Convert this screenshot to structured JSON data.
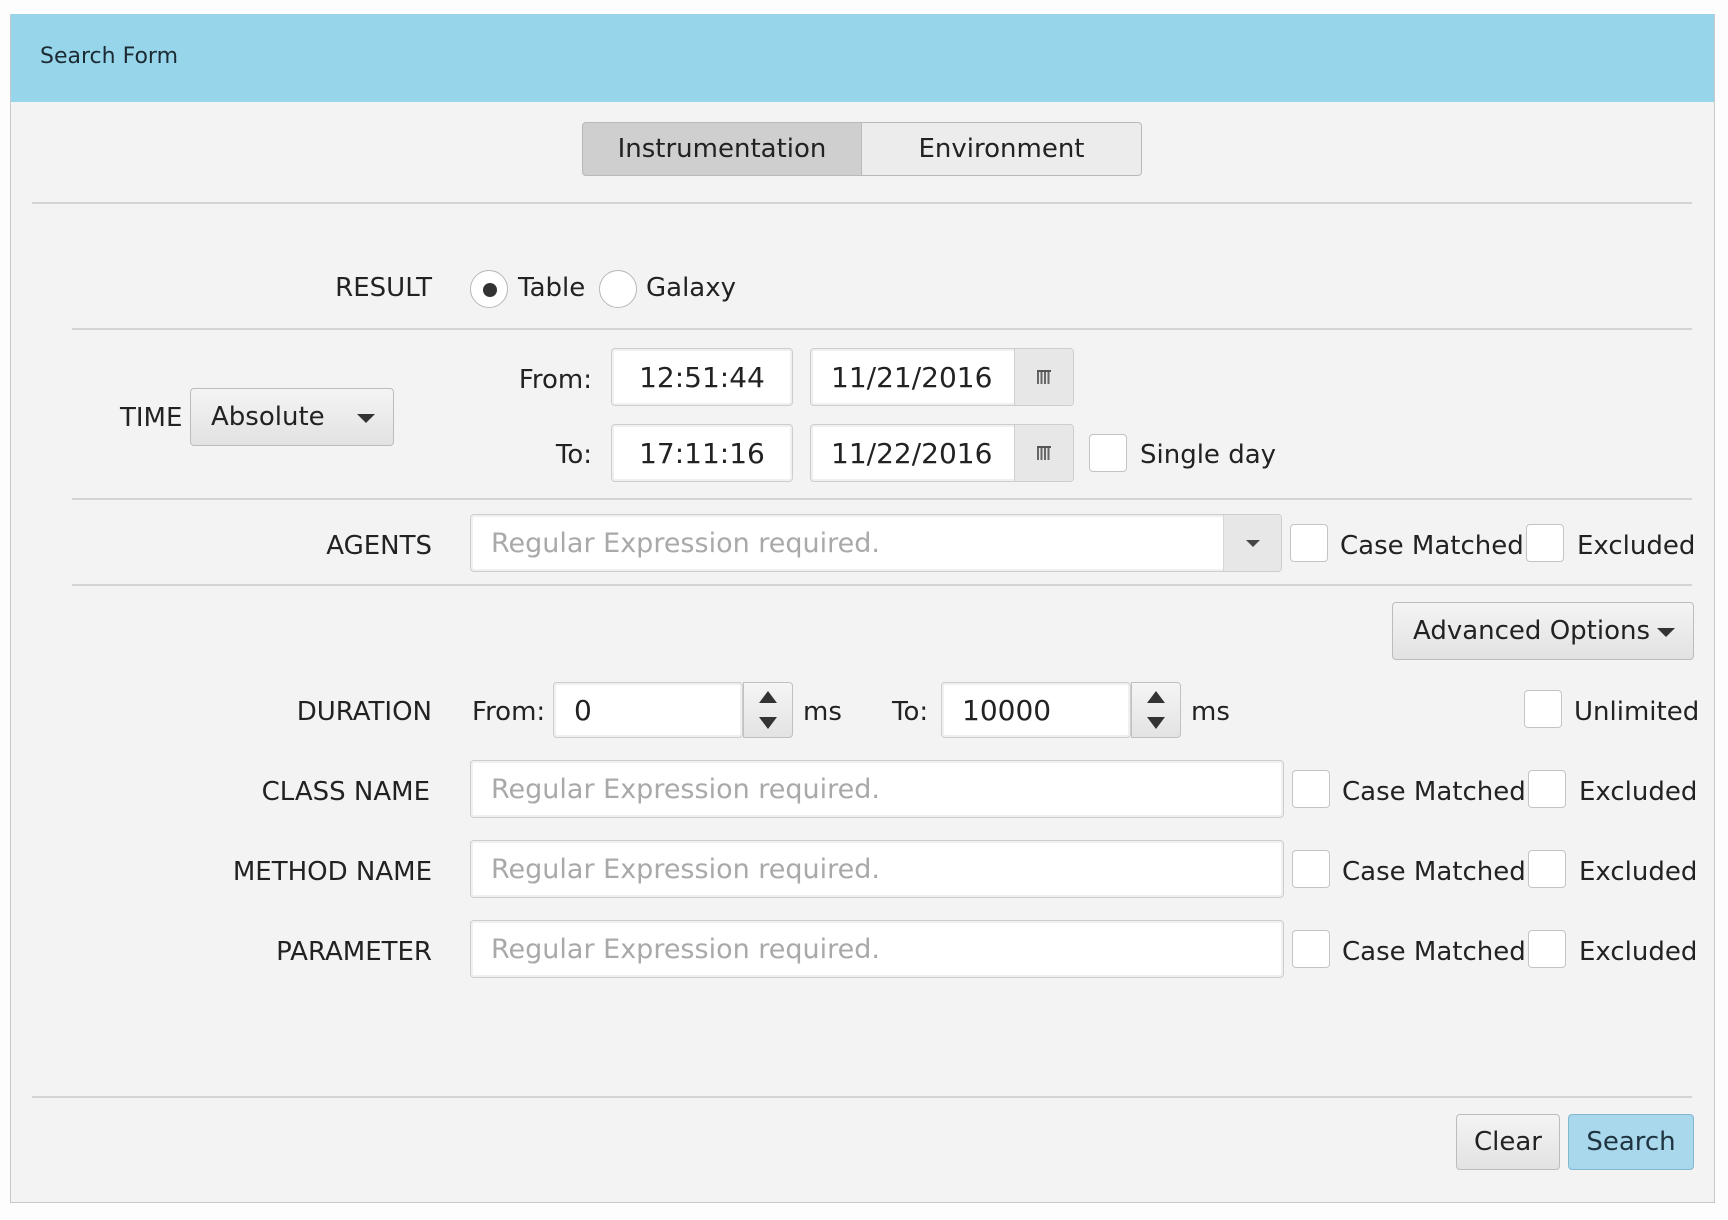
{
  "window": {
    "title": "Search Form"
  },
  "tabs": [
    {
      "label": "Instrumentation",
      "selected": true
    },
    {
      "label": "Environment",
      "selected": false
    }
  ],
  "result": {
    "label": "RESULT",
    "options": [
      {
        "label": "Table",
        "selected": true
      },
      {
        "label": "Galaxy",
        "selected": false
      }
    ]
  },
  "time": {
    "label": "TIME",
    "mode": "Absolute",
    "from_label": "From:",
    "to_label": "To:",
    "from_time": "12:51:44",
    "from_date": "11/21/2016",
    "to_time": "17:11:16",
    "to_date": "11/22/2016",
    "single_day_label": "Single day",
    "single_day_checked": false
  },
  "agents": {
    "label": "AGENTS",
    "placeholder": "Regular Expression required.",
    "case_label": "Case Matched",
    "excluded_label": "Excluded"
  },
  "advanced_options_label": "Advanced Options",
  "duration": {
    "label": "DURATION",
    "from_label": "From:",
    "from_value": "0",
    "unit": "ms",
    "to_label": "To:",
    "to_value": "10000",
    "unit2": "ms",
    "unlimited_label": "Unlimited"
  },
  "class_name": {
    "label": "CLASS NAME",
    "placeholder": "Regular Expression required.",
    "case_label": "Case Matched",
    "excluded_label": "Excluded"
  },
  "method_name": {
    "label": "METHOD NAME",
    "placeholder": "Regular Expression required.",
    "case_label": "Case Matched",
    "excluded_label": "Excluded"
  },
  "parameter": {
    "label": "PARAMETER",
    "placeholder": "Regular Expression required.",
    "case_label": "Case Matched",
    "excluded_label": "Excluded"
  },
  "buttons": {
    "clear": "Clear",
    "search": "Search"
  },
  "colors": {
    "titlebar": "#97d6ea",
    "search_button": "#a9d8ec",
    "background": "#f3f3f3"
  }
}
